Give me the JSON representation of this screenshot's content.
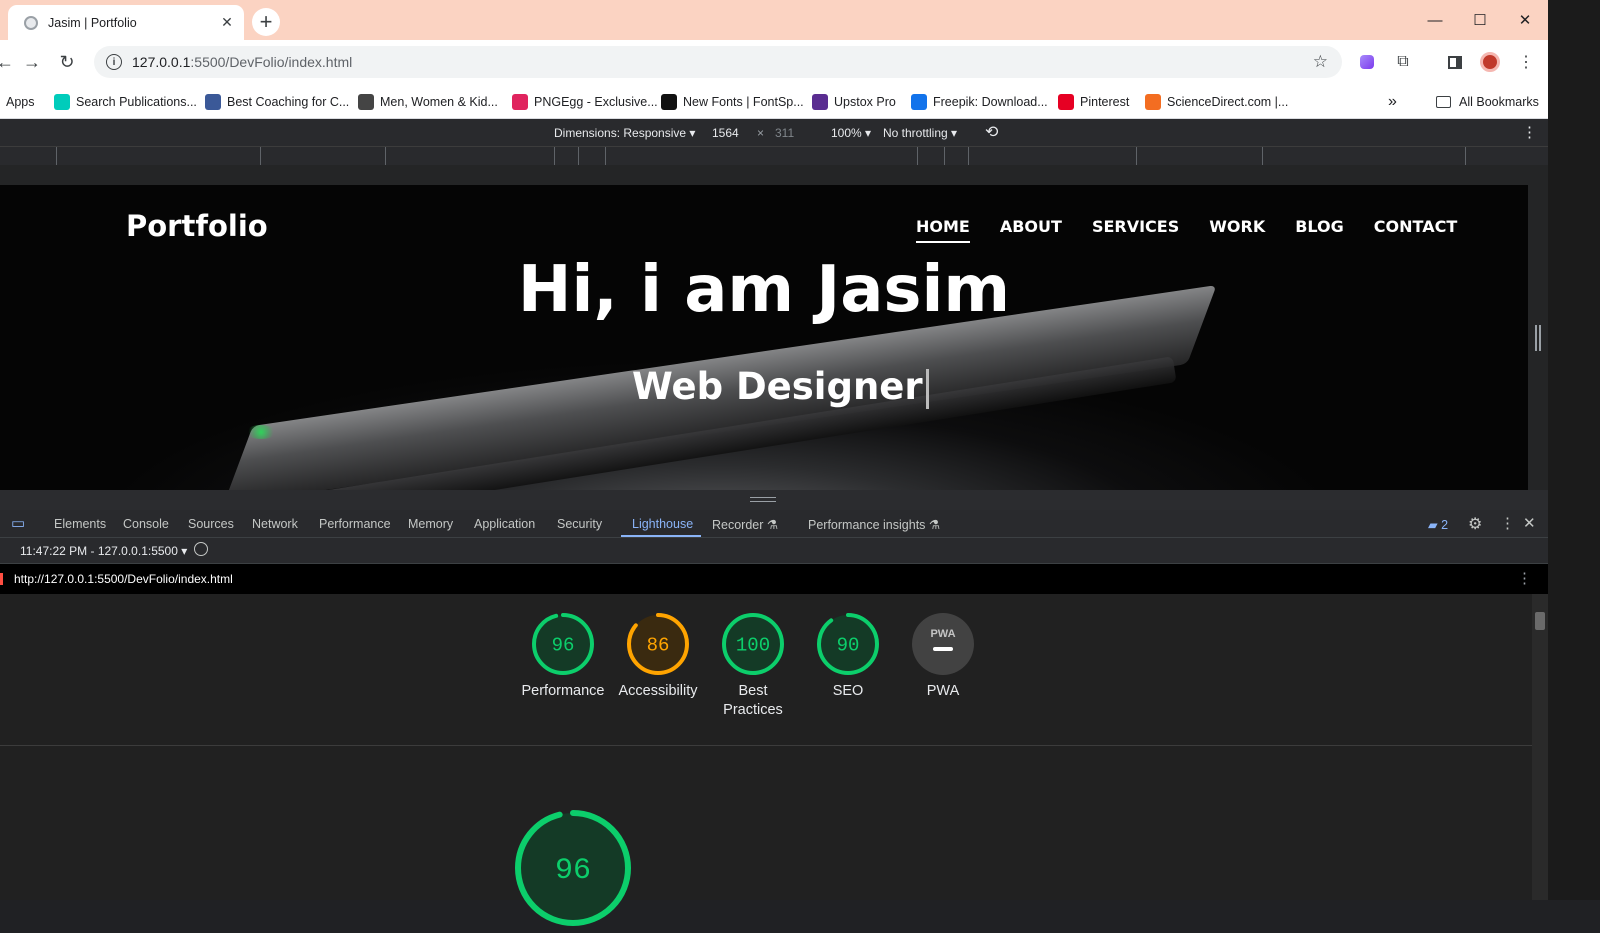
{
  "browser": {
    "tab_title": "Jasim | Portfolio",
    "tab_close": "✕",
    "new_tab": "+",
    "window": {
      "minimize": "—",
      "maximize": "☐",
      "close": "✕"
    },
    "url_host": "127.0.0.1",
    "url_path": ":5500/DevFolio/index.html",
    "bookmarks": [
      {
        "label": "Apps",
        "icon": "apps-grid-icon",
        "color": "#5f6368"
      },
      {
        "label": "Search Publications...",
        "icon": "researchgate-icon",
        "color": "#00ccbb"
      },
      {
        "label": "Best Coaching for C...",
        "icon": "coaching-icon",
        "color": "#3b5998"
      },
      {
        "label": "Men, Women & Kid...",
        "icon": "fashion-icon",
        "color": "#444444"
      },
      {
        "label": "PNGEgg - Exclusive...",
        "icon": "pngegg-icon",
        "color": "#e0245e"
      },
      {
        "label": "New Fonts | FontSp...",
        "icon": "fontspace-icon",
        "color": "#111111"
      },
      {
        "label": "Upstox Pro",
        "icon": "upstox-icon",
        "color": "#5a2d91"
      },
      {
        "label": "Freepik: Download...",
        "icon": "freepik-icon",
        "color": "#1273eb"
      },
      {
        "label": "Pinterest",
        "icon": "pinterest-icon",
        "color": "#e60023"
      },
      {
        "label": "ScienceDirect.com |...",
        "icon": "sciencedirect-icon",
        "color": "#f36d21"
      }
    ],
    "all_bookmarks": "All Bookmarks",
    "more_bookmarks": "»"
  },
  "device_toolbar": {
    "dimensions": "Dimensions: Responsive",
    "width": "1564",
    "times": "×",
    "height": "311",
    "zoom": "100%",
    "throttling": "No throttling"
  },
  "site": {
    "logo": "Portfolio",
    "nav": [
      "HOME",
      "ABOUT",
      "SERVICES",
      "WORK",
      "BLOG",
      "CONTACT"
    ],
    "active_nav": "HOME",
    "hero_title": "Hi, i am Jasim",
    "hero_subtitle": "Web Designer"
  },
  "devtools": {
    "tabs": [
      "Elements",
      "Console",
      "Sources",
      "Network",
      "Performance",
      "Memory",
      "Application",
      "Security",
      "Lighthouse",
      "Recorder",
      "Performance insights"
    ],
    "active_tab": "Lighthouse",
    "issues_count": "2",
    "report_select": "11:47:22 PM - 127.0.0.1:5500",
    "report_url": "http://127.0.0.1:5500/DevFolio/index.html"
  },
  "lighthouse": {
    "scores": [
      {
        "label": "Performance",
        "value": "96",
        "fraction": 0.96,
        "color": "#0cce6b"
      },
      {
        "label": "Accessibility",
        "value": "86",
        "fraction": 0.86,
        "color": "#ffa400"
      },
      {
        "label": "Best Practices",
        "value": "100",
        "fraction": 1.0,
        "color": "#0cce6b"
      },
      {
        "label": "SEO",
        "value": "90",
        "fraction": 0.9,
        "color": "#0cce6b"
      }
    ],
    "pwa": {
      "label": "PWA",
      "badge": "PWA"
    },
    "large_score": {
      "value": "96",
      "fraction": 0.96,
      "color": "#0cce6b"
    }
  }
}
